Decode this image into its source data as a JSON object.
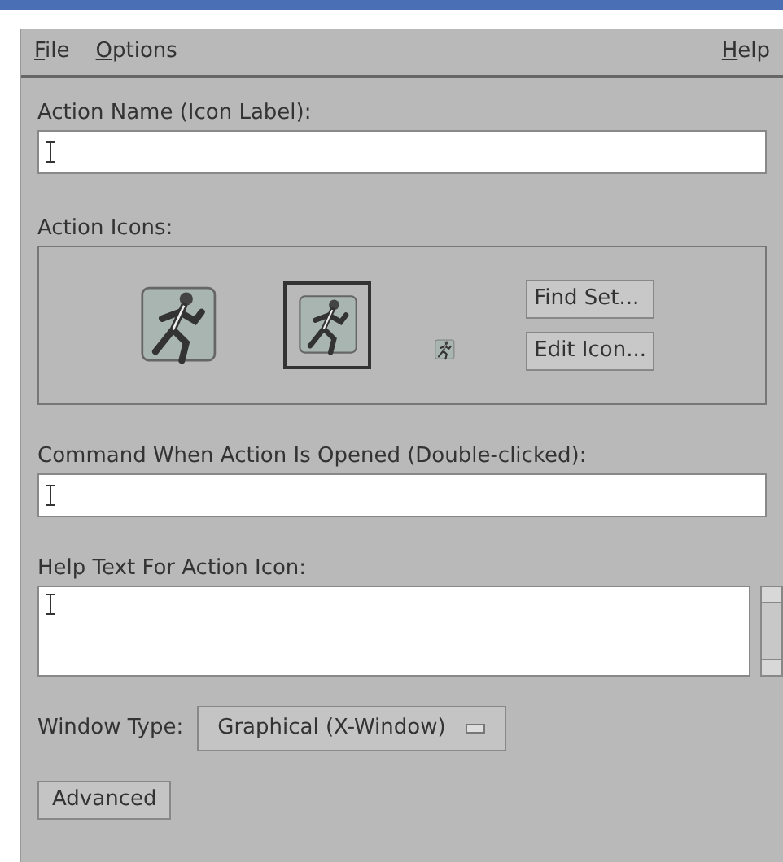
{
  "menu": [
    {
      "label": "File"
    },
    {
      "label": "Options"
    },
    {
      "label": "Help"
    }
  ],
  "action_name": {
    "label": "Action Name (Icon Label):"
  },
  "action_icons": {
    "label": "Action Icons:",
    "icons": [
      {
        "kind": "large",
        "selected": false
      },
      {
        "kind": "medium",
        "selected": true
      },
      {
        "kind": "tiny",
        "selected": false
      }
    ],
    "buttons": [
      "Find Set...",
      "Edit Icon..."
    ]
  },
  "command": {
    "label": "Command When Action Is Opened (Double-clicked):"
  },
  "help_text": {
    "label": "Help Text For Action Icon:"
  },
  "window_type": {
    "label": "Window Type:",
    "value": "Graphical (X-Window)"
  },
  "advanced_button": "Advanced"
}
